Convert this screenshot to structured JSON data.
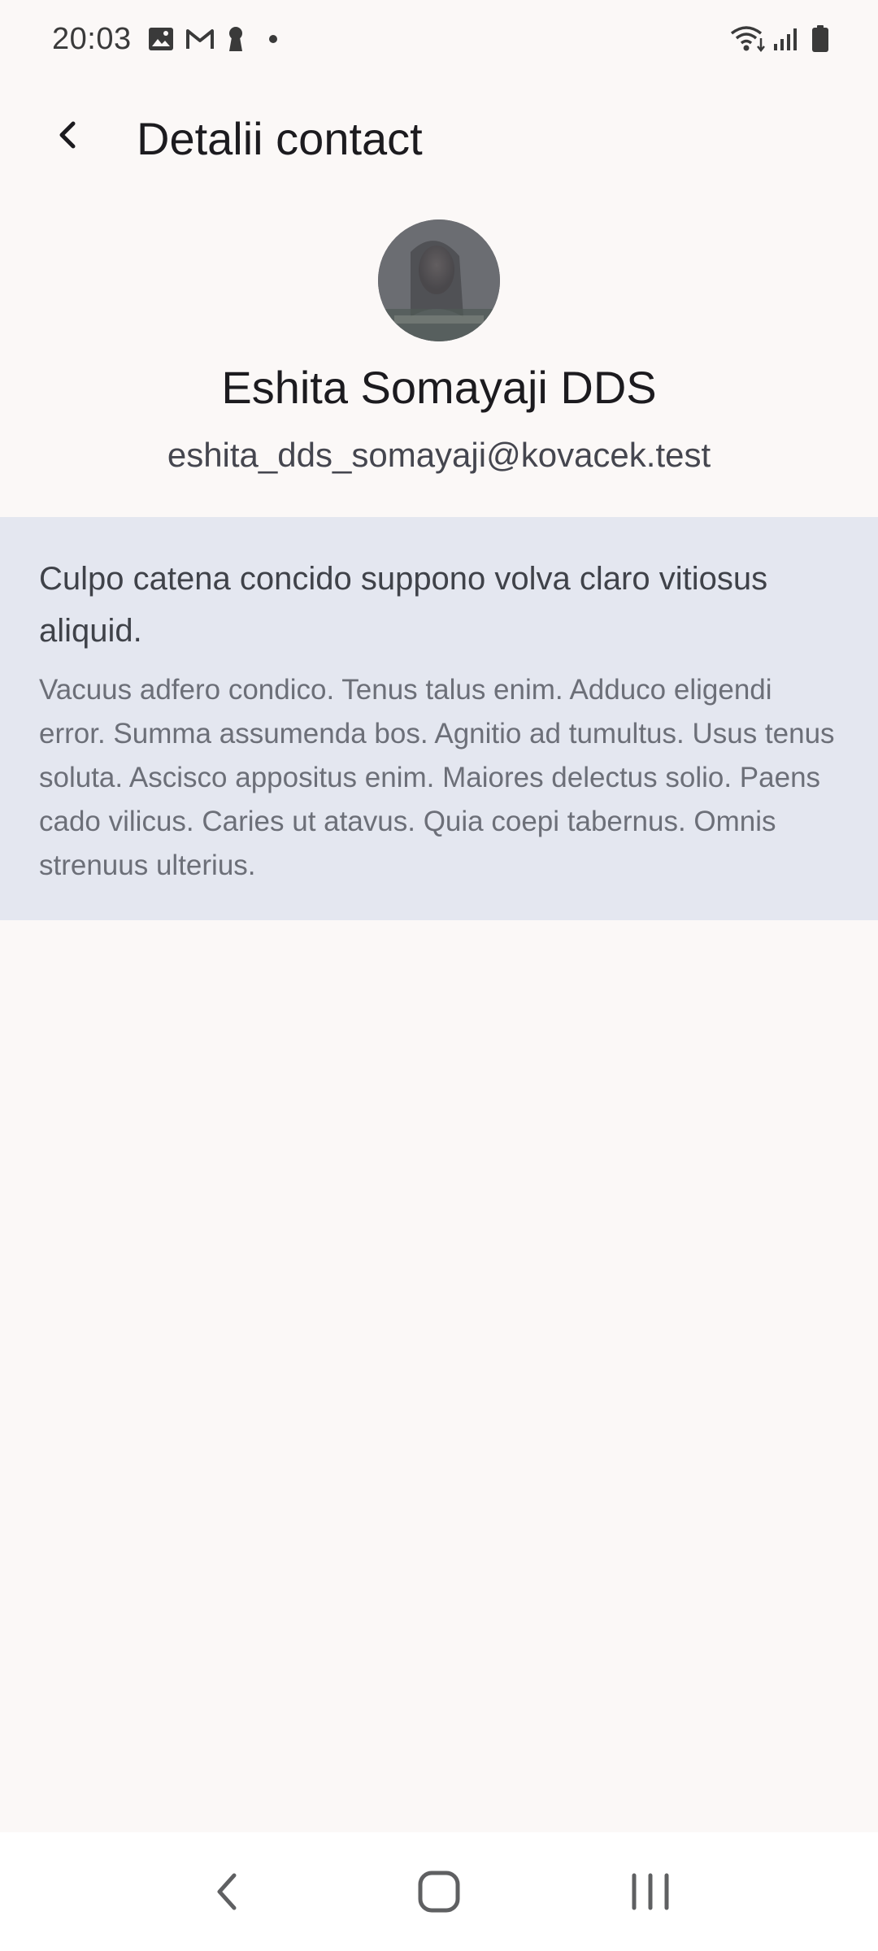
{
  "status_bar": {
    "time": "20:03",
    "left_icons": [
      "image-icon",
      "gmail-icon",
      "keyhole-icon",
      "dot-icon"
    ],
    "right_icons": [
      "wifi-icon",
      "signal-icon",
      "battery-icon"
    ]
  },
  "app_bar": {
    "title": "Detalii contact",
    "back_icon": "arrow-back-icon"
  },
  "contact": {
    "name": "Eshita Somayaji DDS",
    "email": "eshita_dds_somayaji@kovacek.test"
  },
  "note": {
    "title": "Culpo catena concido suppono volva claro vitiosus aliquid.",
    "body": "Vacuus adfero condico. Tenus talus enim. Adduco eligendi error. Summa assumenda bos. Agnitio ad tumultus. Usus tenus soluta. Ascisco appositus enim. Maiores delectus solio. Paens cado vilicus. Caries ut atavus. Quia coepi tabernus. Omnis strenuus ulterius."
  },
  "nav_bar": {
    "buttons": [
      "nav-back-icon",
      "nav-home-icon",
      "nav-recents-icon"
    ]
  },
  "colors": {
    "background": "#FBF8F7",
    "note_background": "#E4E7F0",
    "nav_background": "#FFFFFF"
  }
}
